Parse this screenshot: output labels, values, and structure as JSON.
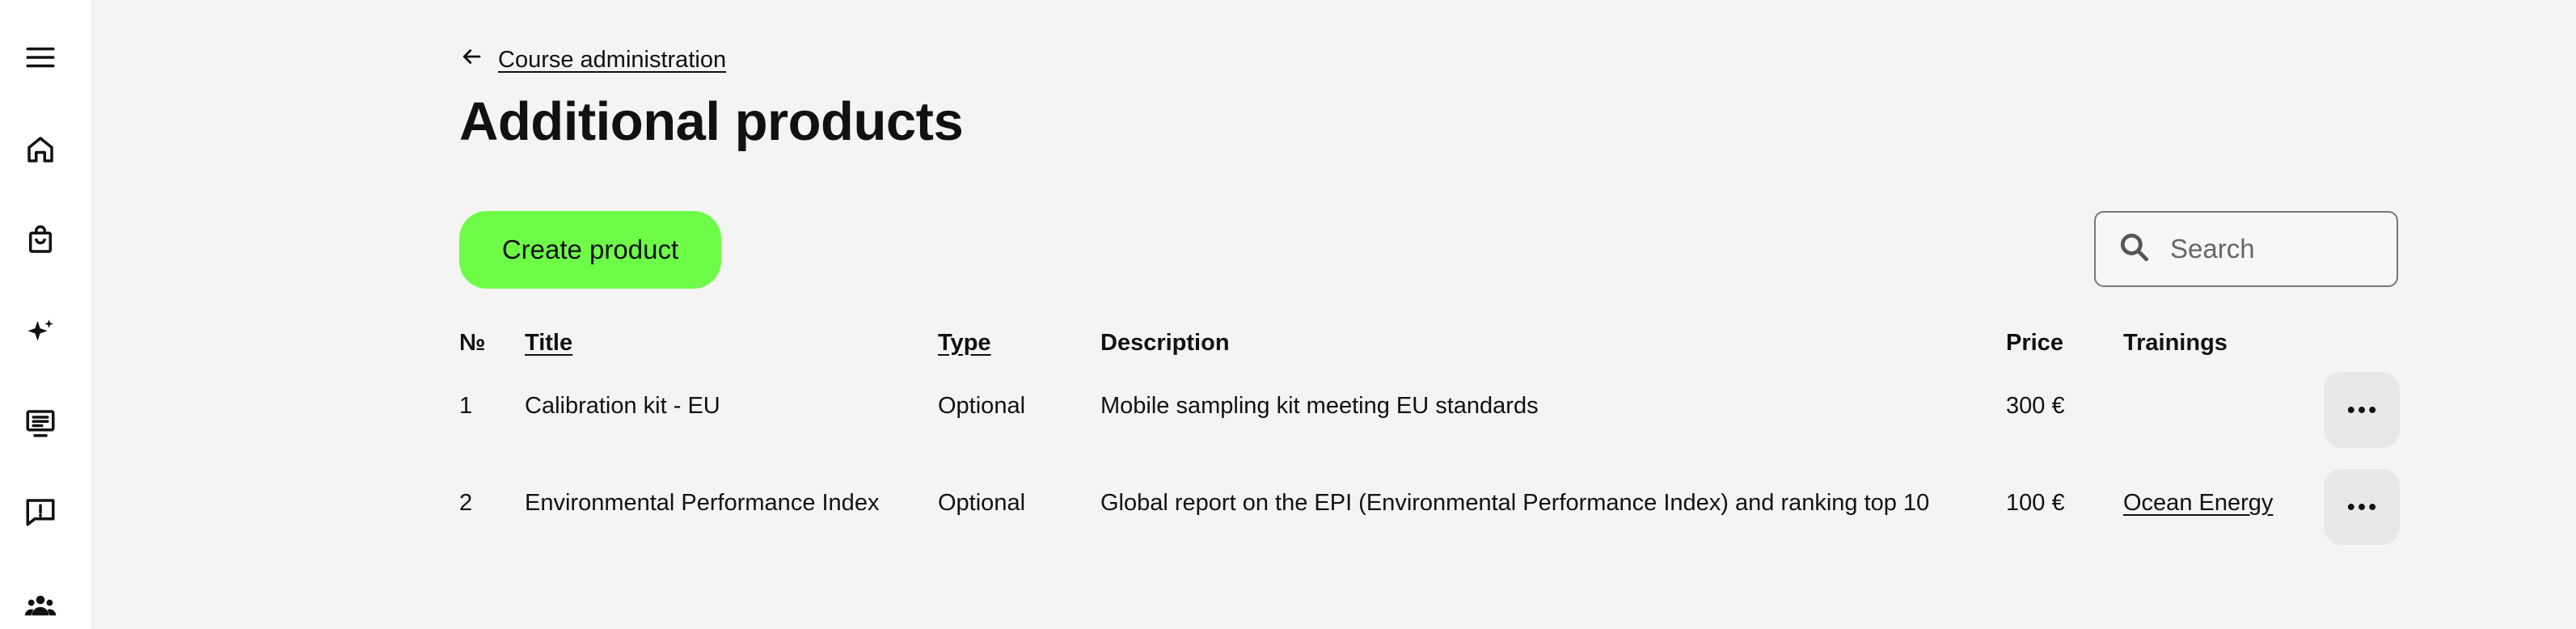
{
  "sidebar": {
    "icons": [
      "menu-icon",
      "home-icon",
      "shopping-bag-icon",
      "sparkles-icon",
      "display-list-icon",
      "feedback-icon",
      "users-icon"
    ]
  },
  "breadcrumb": {
    "back_label": "Course administration"
  },
  "page": {
    "title": "Additional products"
  },
  "toolbar": {
    "create_label": "Create product",
    "search_placeholder": "Search"
  },
  "table": {
    "headers": {
      "no": "№",
      "title": "Title",
      "type": "Type",
      "description": "Description",
      "price": "Price",
      "trainings": "Trainings"
    },
    "rows": [
      {
        "no": "1",
        "title": "Calibration kit - EU",
        "type": "Optional",
        "description": "Mobile sampling kit meeting EU standards",
        "price": "300 €",
        "trainings": ""
      },
      {
        "no": "2",
        "title": "Environmental Performance Index",
        "type": "Optional",
        "description": "Global report on the EPI (Environmental Performance Index) and ranking top 10",
        "price": "100 €",
        "trainings": "Ocean Energy"
      }
    ]
  },
  "colors": {
    "accent": "#6efb48",
    "background": "#f4f4f4",
    "sidebar": "#ffffff"
  }
}
